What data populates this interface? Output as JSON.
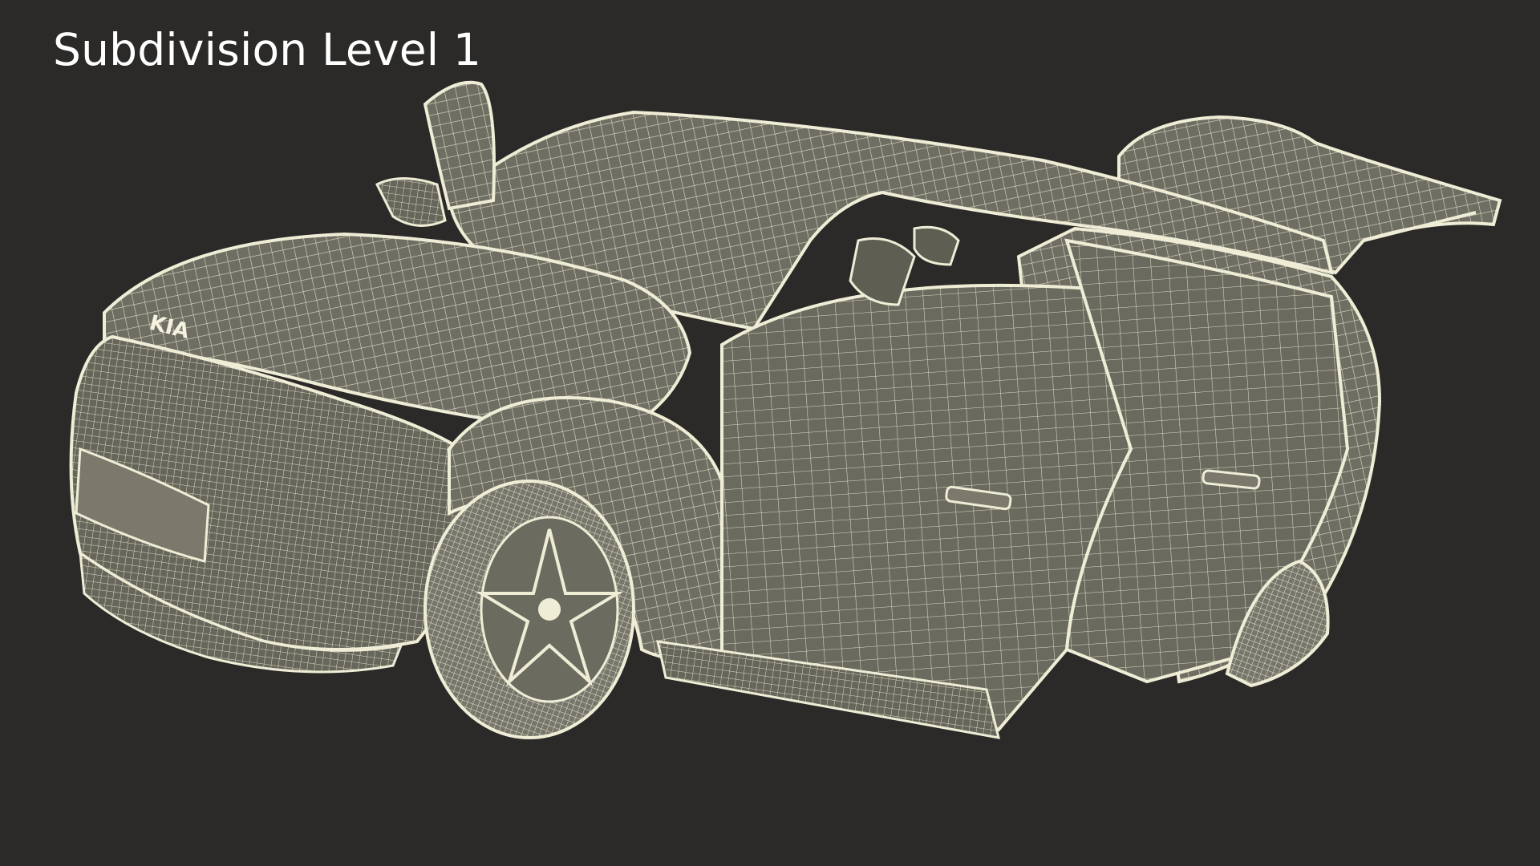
{
  "caption": "Subdivision Level 1",
  "scene": {
    "background_color": "#2b2a28",
    "surface_color": "#6f6e62",
    "wire_color": "#efedd6",
    "model": "car wireframe, doors and tailgate open",
    "badge": "KIA"
  }
}
